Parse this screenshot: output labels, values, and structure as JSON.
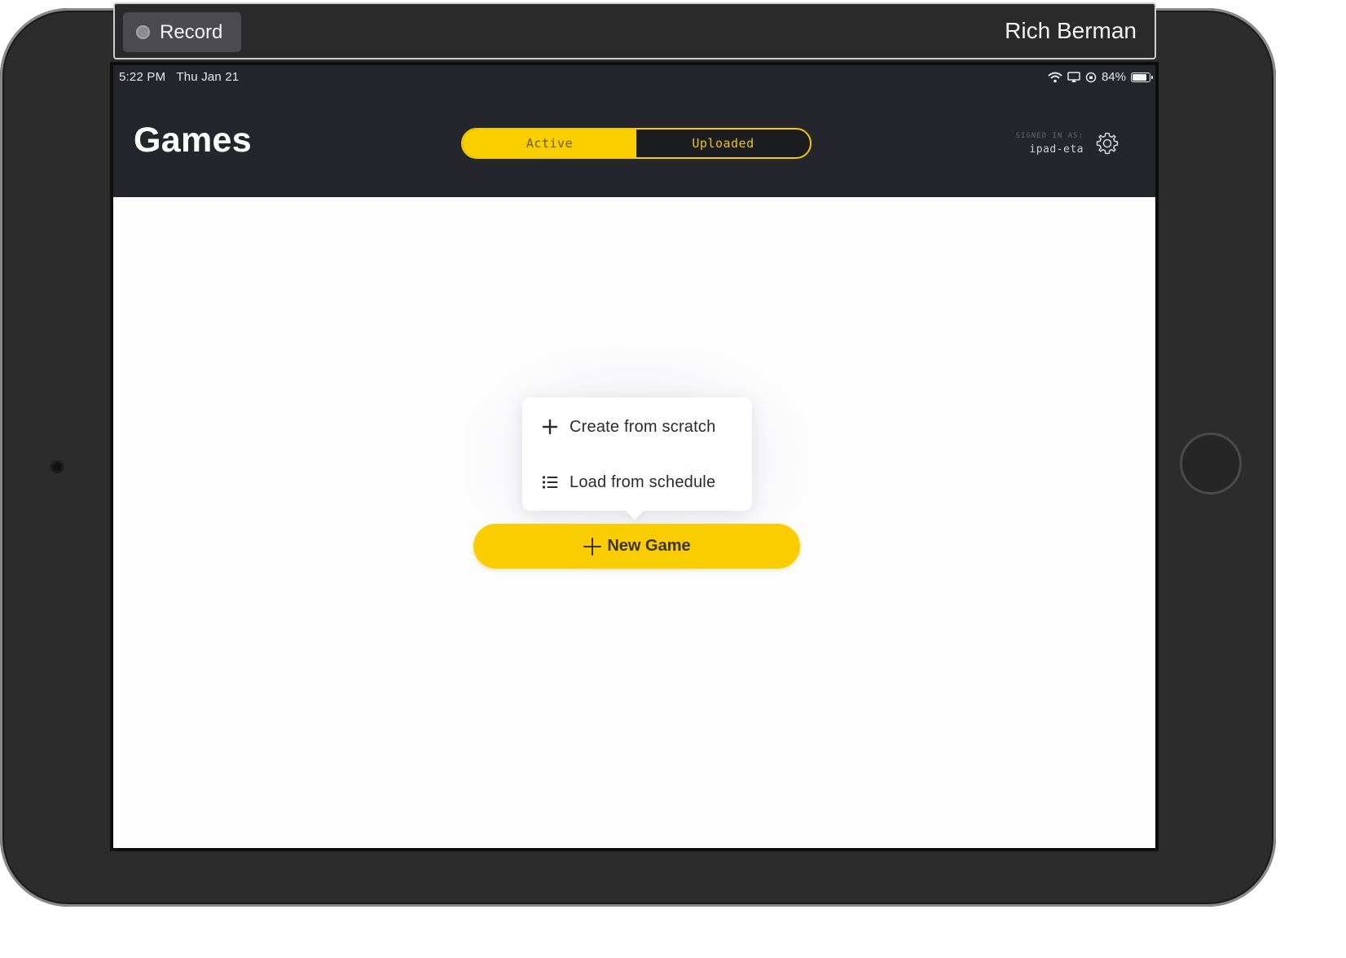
{
  "recorder": {
    "record_label": "Record",
    "user_name": "Rich Berman"
  },
  "status_bar": {
    "time": "5:22 PM",
    "date": "Thu Jan 21",
    "battery": "84%",
    "battery_level": 0.84
  },
  "header": {
    "title": "Games",
    "tabs": [
      {
        "label": "Active",
        "selected": true
      },
      {
        "label": "Uploaded",
        "selected": false
      }
    ],
    "signed_in_label": "SIGNED IN AS:",
    "signed_in_user": "ipad-eta"
  },
  "menu": {
    "items": [
      {
        "label": "Create from scratch",
        "icon": "plus-icon"
      },
      {
        "label": "Load from schedule",
        "icon": "list-icon"
      }
    ]
  },
  "new_game_button": {
    "label": "New Game",
    "icon": "plus-icon"
  },
  "colors": {
    "accent_yellow": "#f9cd00",
    "header_bg": "#25262c",
    "screen_bg": "#fdfdfd"
  }
}
